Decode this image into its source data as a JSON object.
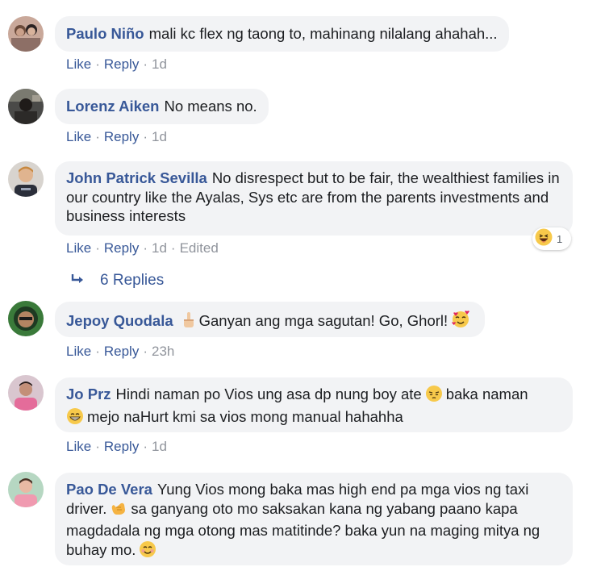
{
  "actions": {
    "like": "Like",
    "reply": "Reply"
  },
  "comments": [
    {
      "author": "Paulo Niño",
      "text": "mali kc flex ng taong to, mahinang nilalang ahahah...",
      "time": "1d"
    },
    {
      "author": "Lorenz Aiken",
      "text": "No means no.",
      "time": "1d"
    },
    {
      "author": "John Patrick Sevilla",
      "text": "No disrespect but to be fair, the wealthiest families in our country like the Ayalas, Sys etc are from the parents investments and business interests",
      "time": "1d",
      "edited": "Edited",
      "reaction_count": "1",
      "replies_label": "6 Replies"
    },
    {
      "author": "Jepoy Quodala",
      "text_a": "Ganyan ang mga sagutan! Go, Ghorl!",
      "time": "23h"
    },
    {
      "author": "Jo Prz",
      "text_a": "Hindi naman po Vios ung asa dp nung boy ate",
      "text_b": "baka naman",
      "text_c": "mejo naHurt kmi sa vios mong manual hahahha",
      "time": "1d"
    },
    {
      "author": "Pao De Vera",
      "text_a": "Yung Vios mong baka mas high end pa mga vios ng taxi driver.",
      "text_b": "sa ganyang oto mo saksakan kana ng yabang paano kapa magdadala ng mga otong mas matitinde? baka yun na maging mitya ng buhay mo."
    }
  ],
  "icons": {
    "reply_arrow": "reply-arrow-icon",
    "laugh": "laughing-emoji-icon",
    "point_up": "pointing-up-emoji-icon",
    "heart_face": "smiling-face-with-hearts-emoji-icon",
    "pensive": "pensive-face-emoji-icon",
    "grin": "grinning-face-emoji-icon",
    "call_me": "call-me-hand-emoji-icon",
    "smile": "smiling-face-emoji-icon"
  },
  "colors": {
    "author": "#385898",
    "bubble": "#f2f3f5",
    "meta": "#90949c"
  }
}
